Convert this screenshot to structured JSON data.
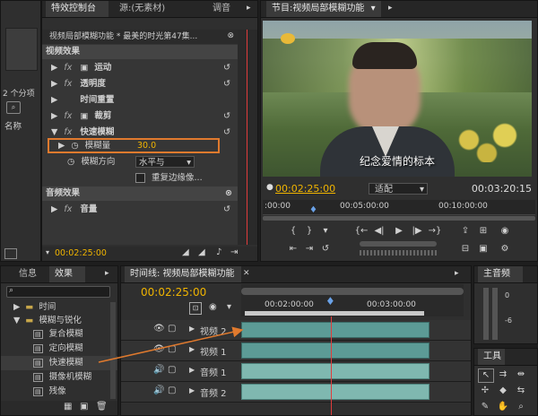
{
  "colors": {
    "accent": "#f0b400",
    "playhead": "#e03c3c",
    "highlight": "#e07a2e",
    "video_clip": "#5c9b96",
    "audio_clip": "#7fb8b0"
  },
  "left_stub": {
    "label1": "2 个分项",
    "label2": "名称"
  },
  "effect_controls": {
    "tabs": [
      "特效控制台",
      "源:(无素材)",
      "调音"
    ],
    "clip_title": "视频局部模糊功能 * 最美的时光第47集...",
    "video_effects": "视频效果",
    "items": [
      {
        "label": "运动",
        "fx": "fx"
      },
      {
        "label": "透明度",
        "fx": "fx"
      },
      {
        "label": "时间重置",
        "fx": ""
      },
      {
        "label": "裁剪",
        "fx": "fx"
      },
      {
        "label": "快速模糊",
        "fx": "fx"
      }
    ],
    "blur_amount_label": "模糊量",
    "blur_amount_value": "30.0",
    "blur_direction_label": "模糊方向",
    "blur_direction_value": "水平与",
    "repeat_edge_label": "重复边缘像...",
    "audio_effects": "音频效果",
    "volume_label": "音量",
    "timecode": "00:02:25:00"
  },
  "program": {
    "tab": "节目:视频局部模糊功能",
    "subtitle": "纪念爱情的标本",
    "timecode_left": "00:02:25:00",
    "fit": "适配",
    "timecode_right": "00:03:20:15",
    "ruler": [
      ":00:00",
      "00:05:00:00",
      "00:10:00:00"
    ]
  },
  "effects_panel": {
    "tabs": [
      "信息",
      "效果"
    ],
    "items": [
      "时间",
      "模糊与锐化",
      "复合模糊",
      "定向模糊",
      "快速模糊",
      "摄像机模糊",
      "残像"
    ]
  },
  "timeline": {
    "tab": "时间线: 视频局部模糊功能",
    "timecode": "00:02:25:00",
    "ruler": [
      "00:02:00:00",
      "00:03:00:00"
    ],
    "tracks": [
      {
        "name": "视频 2",
        "type": "video"
      },
      {
        "name": "视频 1",
        "type": "video"
      },
      {
        "name": "音频 1",
        "type": "audio"
      },
      {
        "name": "音频 2",
        "type": "audio"
      }
    ]
  },
  "audio_master": {
    "tab": "主音频",
    "ticks": [
      "0",
      "-6"
    ]
  },
  "tools": {
    "tab": "工具"
  }
}
